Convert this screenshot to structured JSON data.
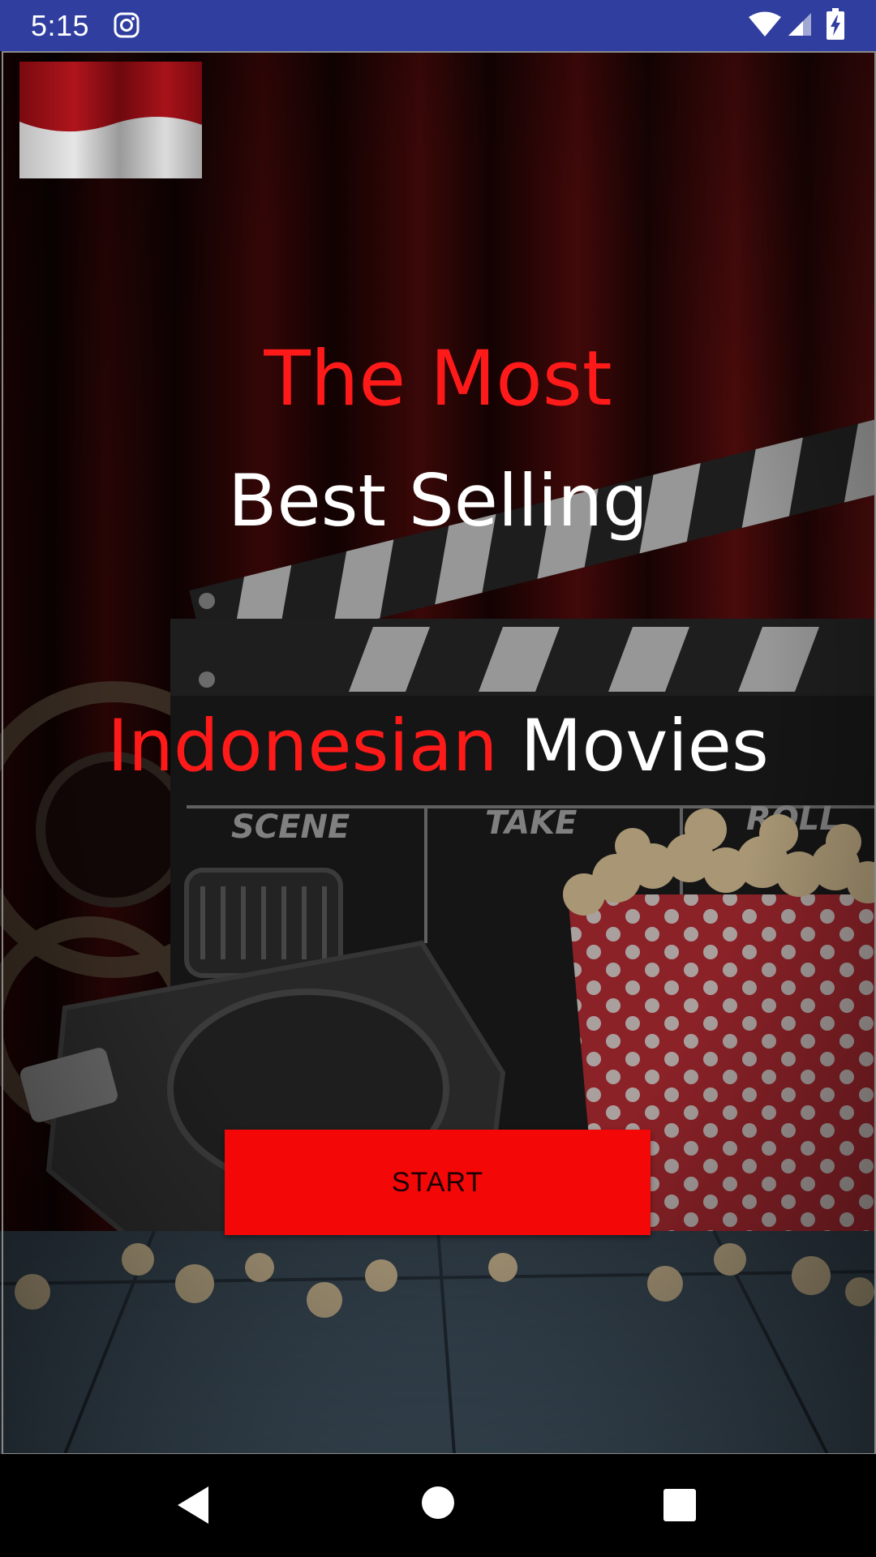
{
  "status_bar": {
    "time": "5:15",
    "icons": [
      "instagram-icon",
      "wifi-icon",
      "signal-icon",
      "battery-charging-icon"
    ],
    "background_color": "#303f9f"
  },
  "app": {
    "flag_icon": "indonesia-flag-icon",
    "headline": {
      "line1": "The Most",
      "line2": "Best Selling",
      "line3_word1": "Indonesian",
      "line3_word2": "Movies"
    },
    "colors": {
      "accent_red": "#ff1a1a",
      "text_white": "#ffffff",
      "button_red": "#f40707"
    },
    "start_button_label": "START"
  },
  "nav_bar": {
    "icons": [
      "back-icon",
      "home-icon",
      "recents-icon"
    ]
  }
}
